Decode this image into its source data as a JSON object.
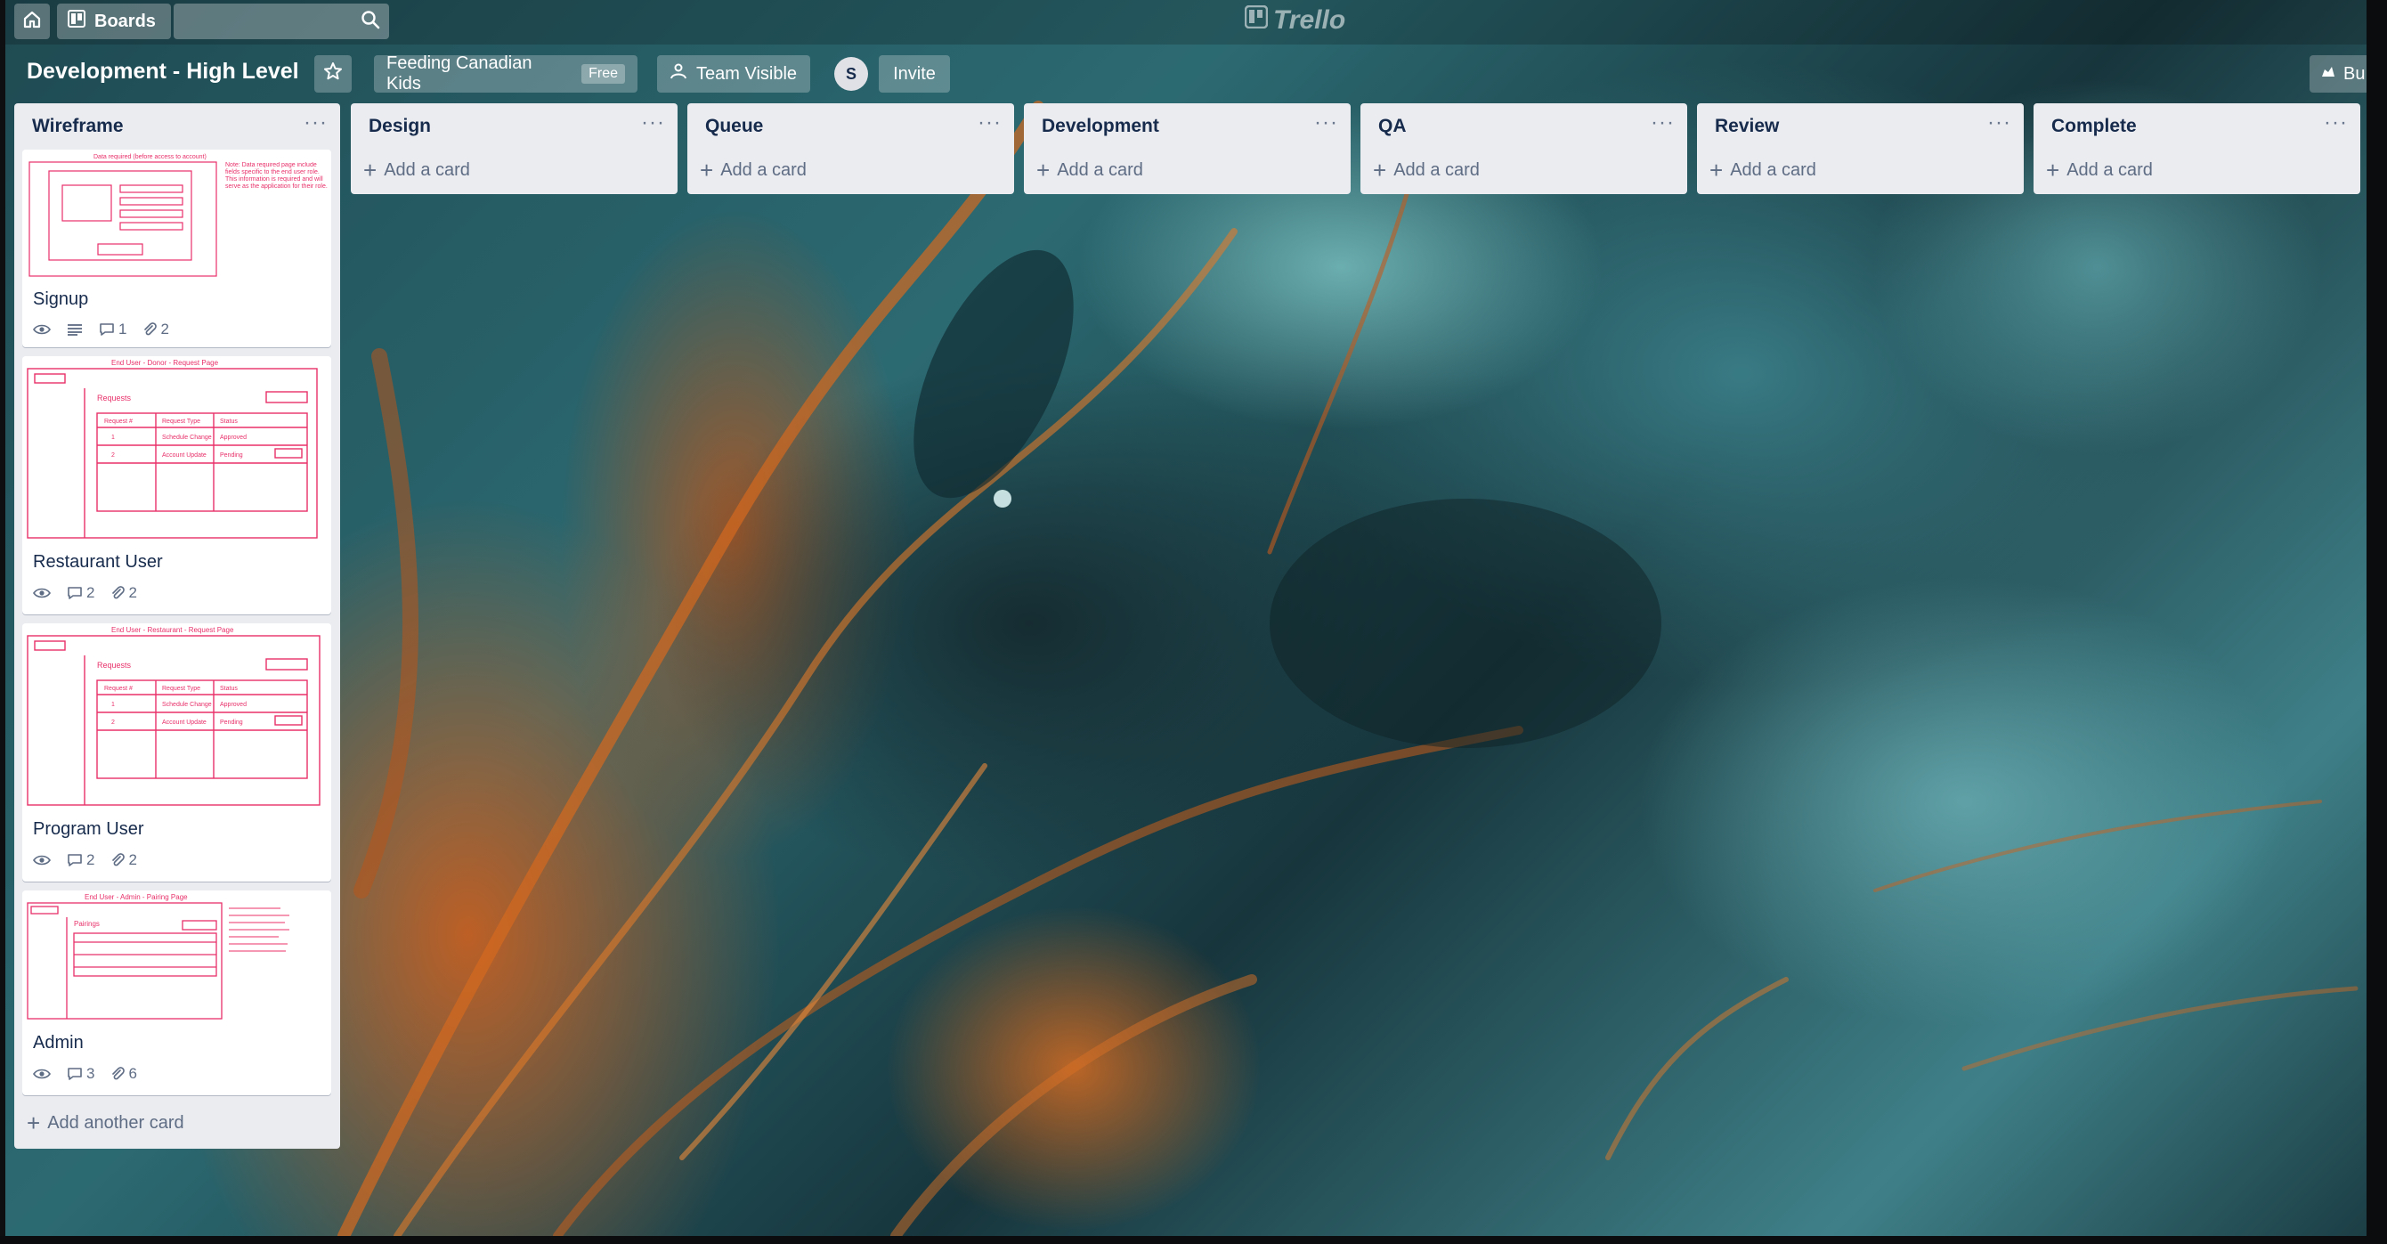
{
  "header": {
    "boards_label": "Boards",
    "logo_text": "Trello"
  },
  "board": {
    "title": "Development - High Level",
    "team": "Feeding Canadian Kids",
    "team_badge": "Free",
    "visibility": "Team Visible",
    "avatar_initial": "S",
    "invite_label": "Invite",
    "butler_label": "Bu"
  },
  "lists": [
    {
      "title": "Wireframe",
      "add_label": "Add another card"
    },
    {
      "title": "Design",
      "add_label": "Add a card"
    },
    {
      "title": "Queue",
      "add_label": "Add a card"
    },
    {
      "title": "Development",
      "add_label": "Add a card"
    },
    {
      "title": "QA",
      "add_label": "Add a card"
    },
    {
      "title": "Review",
      "add_label": "Add a card"
    },
    {
      "title": "Complete",
      "add_label": "Add a card"
    }
  ],
  "list_menu_glyph": "···",
  "cards": [
    {
      "title": "Signup",
      "comments": "1",
      "attachments": "2",
      "cover_heading": "Data required (before access to account)",
      "cover_note": "Note: Data required page include fields specific to the end user role. This information is required and will serve as the application for their role."
    },
    {
      "title": "Restaurant User",
      "comments": "2",
      "attachments": "2",
      "cover_heading": "End User - Donor - Request Page",
      "cover_section": "Requests",
      "cover_cols": [
        "Request #",
        "Request Type",
        "Status"
      ],
      "cover_row1": [
        "1",
        "Schedule Change",
        "Approved"
      ],
      "cover_row2": [
        "2",
        "Account Update",
        "Pending"
      ]
    },
    {
      "title": "Program User",
      "comments": "2",
      "attachments": "2",
      "cover_heading": "End User - Restaurant - Request Page",
      "cover_section": "Requests",
      "cover_cols": [
        "Request #",
        "Request Type",
        "Status"
      ],
      "cover_row1": [
        "1",
        "Schedule Change",
        "Approved"
      ],
      "cover_row2": [
        "2",
        "Account Update",
        "Pending"
      ]
    },
    {
      "title": "Admin",
      "comments": "3",
      "attachments": "6",
      "cover_heading": "End User - Admin - Pairing Page",
      "cover_section": "Pairings"
    }
  ]
}
